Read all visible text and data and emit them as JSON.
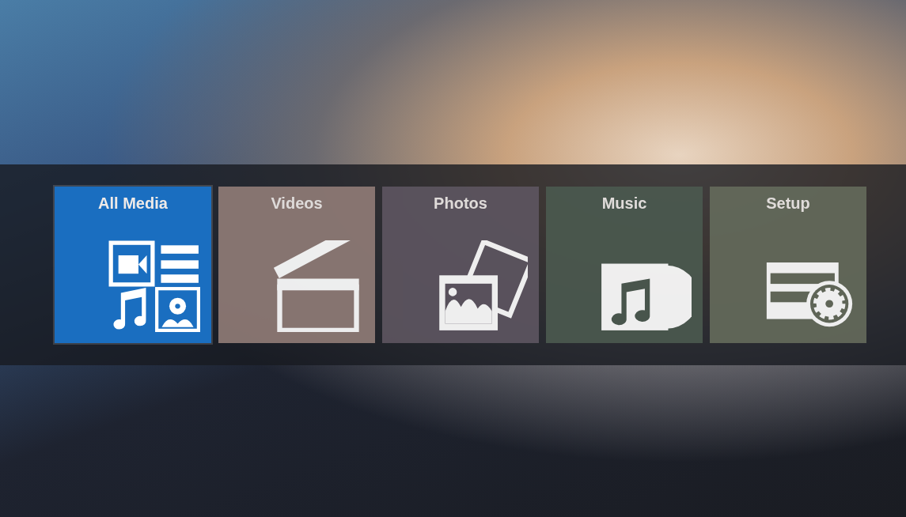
{
  "menu": {
    "tiles": [
      {
        "label": "All Media",
        "kind": "all-media",
        "color": "#1a6ec0",
        "selected": true
      },
      {
        "label": "Videos",
        "kind": "videos",
        "color": "#8f7b76",
        "selected": false
      },
      {
        "label": "Photos",
        "kind": "photos",
        "color": "#5d5560",
        "selected": false
      },
      {
        "label": "Music",
        "kind": "music",
        "color": "#4b594f",
        "selected": false
      },
      {
        "label": "Setup",
        "kind": "setup",
        "color": "#646a5b",
        "selected": false
      }
    ]
  }
}
